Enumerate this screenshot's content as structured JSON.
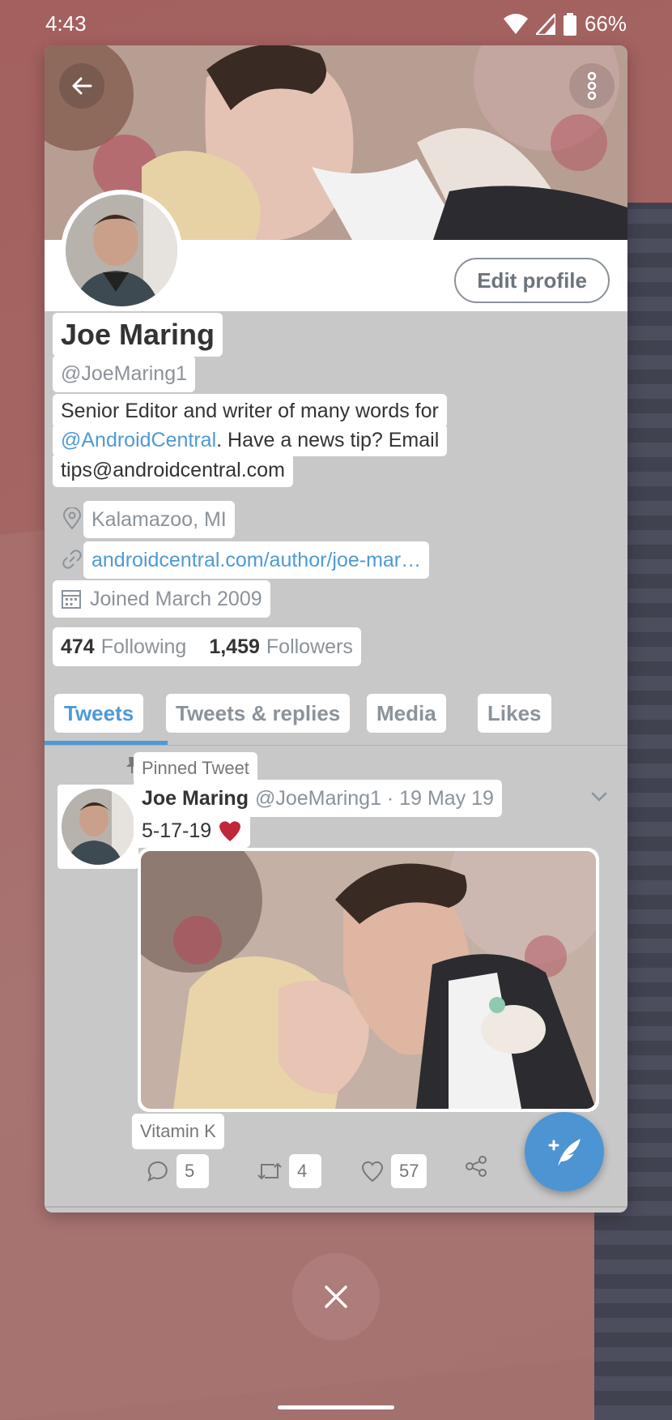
{
  "status_bar": {
    "time": "4:43",
    "battery": "66%"
  },
  "profile": {
    "edit_button": "Edit profile",
    "name": "Joe Maring",
    "handle": "@JoeMaring1",
    "bio": {
      "line1": "Senior Editor and writer of many words for",
      "mention": "@AndroidCentral",
      "line2_rest": ". Have a news tip? Email",
      "line3": "tips@androidcentral.com"
    },
    "location": "Kalamazoo, MI",
    "link": "androidcentral.com/author/joe-mar…",
    "joined": "Joined March 2009",
    "following_count": "474",
    "following_label": "Following",
    "followers_count": "1,459",
    "followers_label": "Followers"
  },
  "tabs": [
    {
      "label": "Tweets",
      "active": true
    },
    {
      "label": "Tweets & replies",
      "active": false
    },
    {
      "label": "Media",
      "active": false
    },
    {
      "label": "Likes",
      "active": false
    }
  ],
  "tweet": {
    "pinned_label": "Pinned Tweet",
    "author": "Joe Maring",
    "meta": "@JoeMaring1 · 19 May 19",
    "text": "5-17-19",
    "media_label": "Vitamin K",
    "replies": "5",
    "retweets": "4",
    "likes": "57"
  },
  "icons": {
    "back": "arrow-left-icon",
    "more": "more-vertical-icon",
    "location": "location-pin-icon",
    "link": "link-icon",
    "calendar": "calendar-icon",
    "pin": "pin-icon",
    "caret": "chevron-down-icon",
    "reply": "reply-icon",
    "retweet": "retweet-icon",
    "like": "heart-icon",
    "share": "share-icon",
    "compose": "compose-tweet-icon",
    "close": "close-icon"
  },
  "colors": {
    "accent": "#4d9ad6",
    "fab": "#4d94d2",
    "heart": "#c0283a"
  }
}
